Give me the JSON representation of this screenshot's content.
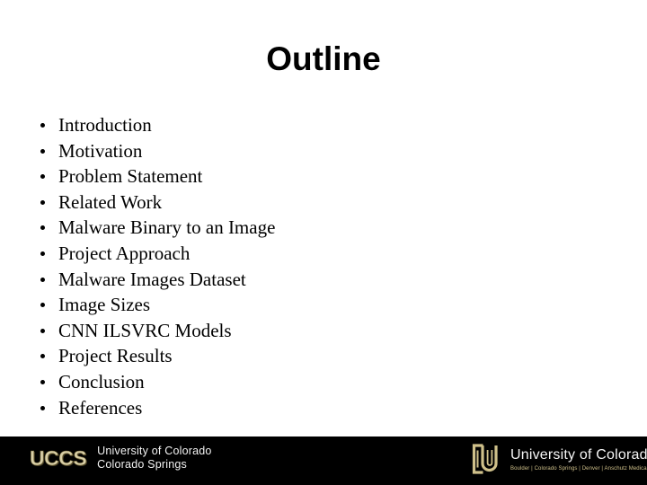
{
  "slide": {
    "title": "Outline",
    "background_color": "#ffffff",
    "text_color": "#000000"
  },
  "outline": {
    "items": [
      {
        "label": "Introduction"
      },
      {
        "label": "Motivation"
      },
      {
        "label": "Problem Statement"
      },
      {
        "label": "Related Work"
      },
      {
        "label": "Malware Binary to an Image"
      },
      {
        "label": "Project Approach"
      },
      {
        "label": "Malware Images Dataset"
      },
      {
        "label": "Image Sizes"
      },
      {
        "label": "CNN ILSVRC Models"
      },
      {
        "label": "Project Results"
      },
      {
        "label": "Conclusion"
      },
      {
        "label": "References"
      }
    ]
  },
  "footer": {
    "background_color": "#000000",
    "accent_color": "#d9cfa8",
    "uccs_logo": {
      "wordmark": "UCCS",
      "name_line1": "University of Colorado",
      "name_line2": "Colorado Springs"
    },
    "cu_logo": {
      "monogram": "CU",
      "title": "University of Colorado",
      "campuses": "Boulder | Colorado Springs | Denver | Anschutz Medical Campus"
    }
  }
}
